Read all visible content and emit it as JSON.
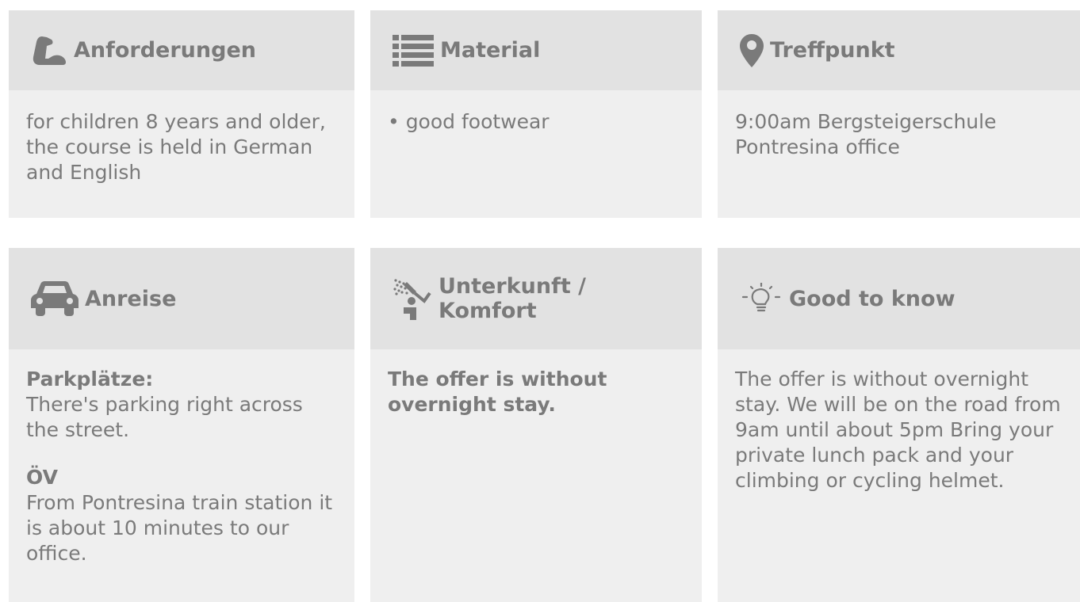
{
  "row1": [
    {
      "icon": "flexed-arm-icon",
      "title": "Anforderungen",
      "lines": [
        "for children 8 years and older, the course is held in German and English"
      ]
    },
    {
      "icon": "list-icon",
      "title": "Material",
      "lines": [
        "• good footwear"
      ]
    },
    {
      "icon": "map-pin-icon",
      "title": "Treffpunkt",
      "lines": [
        "9:00am Bergsteigerschule Pontresina office"
      ]
    }
  ],
  "row2": [
    {
      "icon": "car-icon",
      "title": "Anreise",
      "sections": [
        {
          "heading": "Parkplätze:",
          "text": "There's parking right across the street."
        },
        {
          "heading": "ÖV",
          "text": "From Pontresina train station it is about 10 minutes to our office."
        }
      ]
    },
    {
      "icon": "shower-icon",
      "title": "Unterkunft / Komfort",
      "bold_text": "The offer is without overnight stay."
    },
    {
      "icon": "lightbulb-icon",
      "title": "Good to know",
      "text": "The offer is without overnight stay. We will be on the road from 9am until about 5pm Bring your private lunch pack and your climbing or cycling helmet."
    }
  ],
  "colors": {
    "card_bg": "#efefef",
    "header_bg": "#e2e2e2",
    "text": "#7a7a7a"
  }
}
